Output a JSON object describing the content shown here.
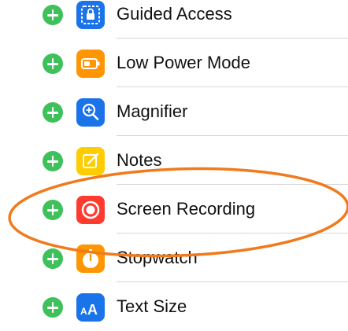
{
  "rows": [
    {
      "label": "Guided Access",
      "icon": "guided-access-icon",
      "color": "#1a73e8"
    },
    {
      "label": "Low Power Mode",
      "icon": "battery-icon",
      "color": "#ff9500"
    },
    {
      "label": "Magnifier",
      "icon": "magnifier-icon",
      "color": "#1a73e8"
    },
    {
      "label": "Notes",
      "icon": "notes-icon",
      "color": "#ffcc00"
    },
    {
      "label": "Screen Recording",
      "icon": "record-icon",
      "color": "#ff3b30"
    },
    {
      "label": "Stopwatch",
      "icon": "stopwatch-icon",
      "color": "#ff9500"
    },
    {
      "label": "Text Size",
      "icon": "text-size-icon",
      "color": "#1a73e8"
    }
  ],
  "annotation": {
    "shape": "ellipse",
    "color": "#f07a1c",
    "target": "Screen Recording"
  },
  "add_button_color": "#3ec15a"
}
